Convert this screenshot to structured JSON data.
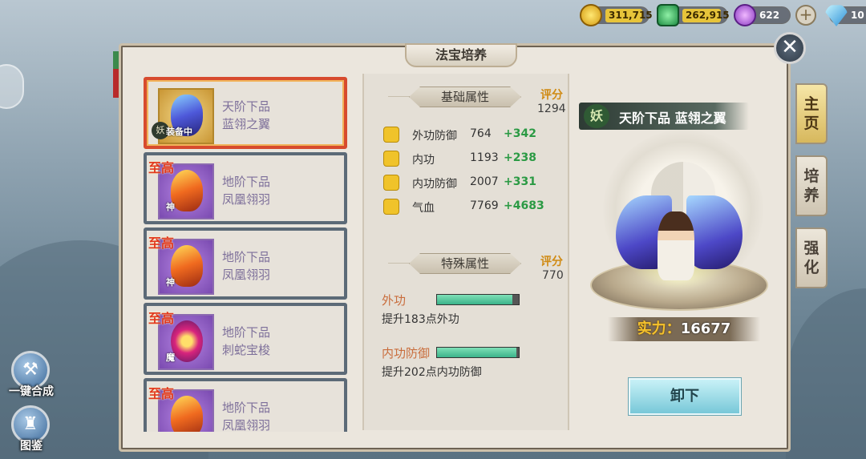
{
  "resources": [
    {
      "name": "gold",
      "icon": "gold-coin-icon",
      "value": "311,715"
    },
    {
      "name": "jade",
      "icon": "green-gem-icon",
      "value": "262,915"
    },
    {
      "name": "spirit",
      "icon": "purple-orb-icon",
      "value": "622"
    },
    {
      "name": "diamond",
      "icon": "diamond-icon",
      "value": "10"
    }
  ],
  "panel": {
    "title": "法宝培养"
  },
  "sidebar": {
    "compose_label": "一键合成",
    "atlas_label": "图鉴"
  },
  "list": {
    "items": [
      {
        "badge": "",
        "tag": "妖",
        "tag2": "装备中",
        "line1": "天阶下品",
        "line2": "蓝翎之翼"
      },
      {
        "badge": "至高",
        "tag": "",
        "tag2": "神",
        "line1": "地阶下品",
        "line2": "凤凰翎羽"
      },
      {
        "badge": "至高",
        "tag": "",
        "tag2": "神",
        "line1": "地阶下品",
        "line2": "凤凰翎羽"
      },
      {
        "badge": "至高",
        "tag": "",
        "tag2": "魔",
        "line1": "地阶下品",
        "line2": "刺蛇宝梭"
      },
      {
        "badge": "至高",
        "tag": "",
        "tag2": "",
        "line1": "地阶下品",
        "line2": "凤凰翎羽"
      }
    ]
  },
  "base": {
    "header": "基础属性",
    "score_label": "评分",
    "score": "1294",
    "attrs": [
      {
        "icon": "armor-icon",
        "name": "外功防御",
        "value": "764",
        "bonus": "+342"
      },
      {
        "icon": "magnifier-icon",
        "name": "内功",
        "value": "1193",
        "bonus": "+238"
      },
      {
        "icon": "shield-icon",
        "name": "内功防御",
        "value": "2007",
        "bonus": "+331"
      },
      {
        "icon": "heart-icon",
        "name": "气血",
        "value": "7769",
        "bonus": "+4683"
      }
    ]
  },
  "special": {
    "header": "特殊属性",
    "score_label": "评分",
    "score": "770",
    "items": [
      {
        "name": "外功",
        "desc": "提升183点外功",
        "progress": 0.92
      },
      {
        "name": "内功防御",
        "desc": "提升202点内功防御",
        "progress": 0.97
      }
    ]
  },
  "detail": {
    "badge": "妖",
    "name": "天阶下品 蓝翎之翼",
    "power_label": "实力：",
    "power": "16677",
    "unequip_label": "卸下"
  },
  "tabs": [
    {
      "label": "主页"
    },
    {
      "label": "培养"
    },
    {
      "label": "强化"
    }
  ],
  "colors": {
    "accent": "#d74b2e",
    "bonus": "#2b9a44",
    "score": "#d08a12"
  }
}
